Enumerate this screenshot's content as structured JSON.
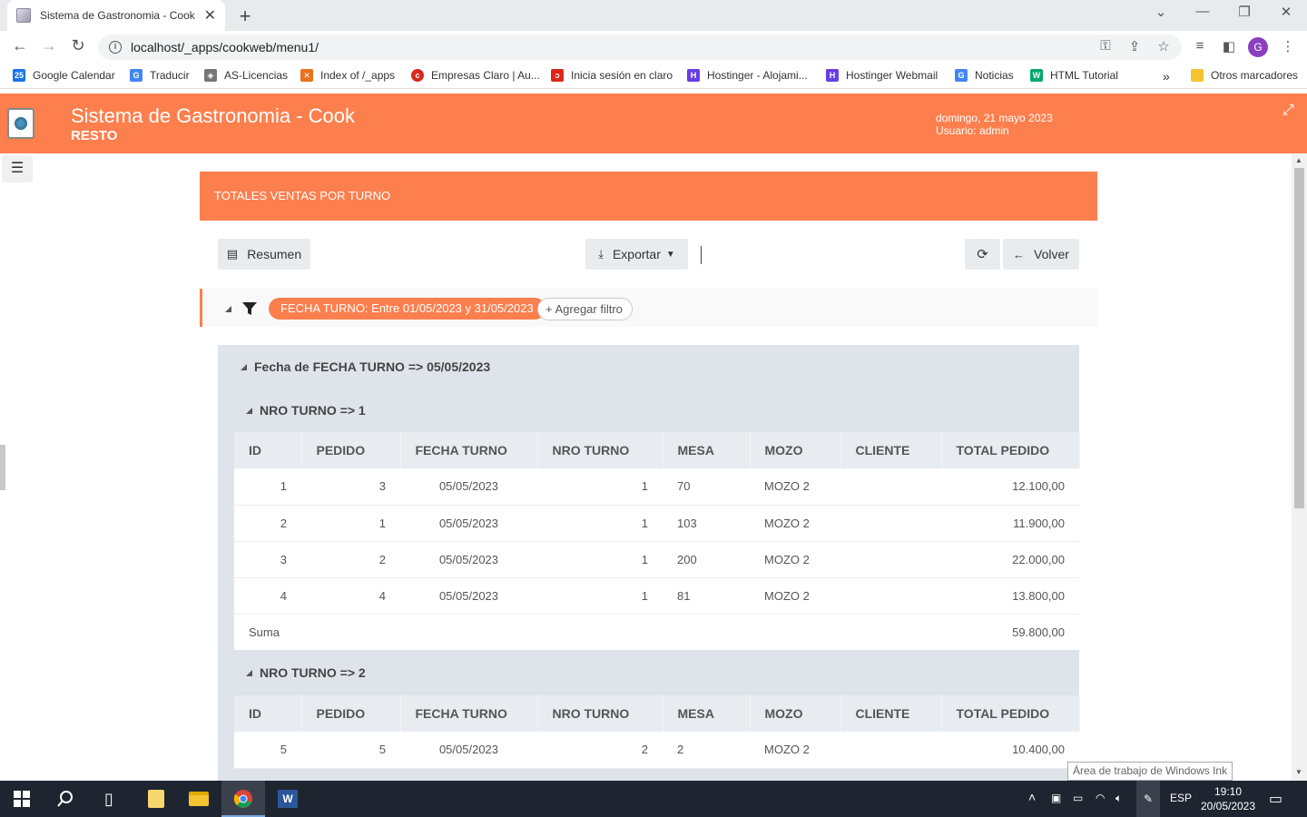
{
  "browser": {
    "tab_title": "Sistema de Gastronomia - Cook",
    "tab_close": "✕",
    "new_tab": "+",
    "url": "localhost/_apps/cookweb/menu1/",
    "profile_initial": "G",
    "bookmarks": [
      {
        "label": "Google Calendar",
        "color": "#1a73e8",
        "icon": "calendar-icon"
      },
      {
        "label": "Traducir",
        "color": "#4285f4",
        "icon": "translate-icon"
      },
      {
        "label": "AS-Licencias",
        "color": "#777777",
        "icon": "license-icon"
      },
      {
        "label": "Index of /_apps",
        "color": "#e8711a",
        "icon": "xampp-icon"
      },
      {
        "label": "Empresas Claro | Au...",
        "color": "#da291c",
        "icon": "claro-icon"
      },
      {
        "label": "Inicia sesión en claro",
        "color": "#da291c",
        "icon": "claro-login-icon"
      },
      {
        "label": "Hostinger - Alojami...",
        "color": "#673de6",
        "icon": "hostinger-icon"
      },
      {
        "label": "Hostinger Webmail",
        "color": "#673de6",
        "icon": "hostinger-icon"
      },
      {
        "label": "Noticias",
        "color": "#4285f4",
        "icon": "news-icon"
      },
      {
        "label": "HTML Tutorial",
        "color": "#04aa6d",
        "icon": "w3-icon"
      }
    ],
    "more_bookmarks": "»",
    "other_bookmarks": "Otros marcadores"
  },
  "app": {
    "title": "Sistema de Gastronomia - Cook",
    "subtitle": "RESTO",
    "date": "domingo, 21 mayo 2023",
    "user": "Usuario: admin"
  },
  "report": {
    "title": "TOTALES VENTAS POR TURNO",
    "btn_resumen": "Resumen",
    "btn_exportar": "Exportar",
    "btn_volver": "Volver",
    "filter_chip": "FECHA TURNO: Entre 01/05/2023 y 31/05/2023",
    "add_filter": "+ Agregar filtro",
    "group_label": "Fecha de FECHA TURNO => 05/05/2023",
    "columns": [
      "ID",
      "PEDIDO",
      "FECHA TURNO",
      "NRO TURNO",
      "MESA",
      "MOZO",
      "CLIENTE",
      "TOTAL PEDIDO"
    ],
    "subgroups": [
      {
        "label": "NRO TURNO => 1",
        "rows": [
          {
            "id": "1",
            "pedido": "3",
            "fecha": "05/05/2023",
            "turno": "1",
            "mesa": "70",
            "mozo": "MOZO 2",
            "cliente": "",
            "total": "12.100,00"
          },
          {
            "id": "2",
            "pedido": "1",
            "fecha": "05/05/2023",
            "turno": "1",
            "mesa": "103",
            "mozo": "MOZO 2",
            "cliente": "",
            "total": "11.900,00"
          },
          {
            "id": "3",
            "pedido": "2",
            "fecha": "05/05/2023",
            "turno": "1",
            "mesa": "200",
            "mozo": "MOZO 2",
            "cliente": "",
            "total": "22.000,00"
          },
          {
            "id": "4",
            "pedido": "4",
            "fecha": "05/05/2023",
            "turno": "1",
            "mesa": "81",
            "mozo": "MOZO 2",
            "cliente": "",
            "total": "13.800,00"
          }
        ],
        "sum_label": "Suma",
        "sum_value": "59.800,00"
      },
      {
        "label": "NRO TURNO => 2",
        "rows": [
          {
            "id": "5",
            "pedido": "5",
            "fecha": "05/05/2023",
            "turno": "2",
            "mesa": "2",
            "mozo": "MOZO 2",
            "cliente": "",
            "total": "10.400,00"
          }
        ]
      }
    ]
  },
  "tooltip": "Área de trabajo de Windows Ink",
  "taskbar": {
    "lang": "ESP",
    "time": "19:10",
    "date": "20/05/2023"
  },
  "colors": {
    "accent": "#fd7f4d",
    "group_bg": "#dfe4ea",
    "taskbar": "#1f2530"
  }
}
